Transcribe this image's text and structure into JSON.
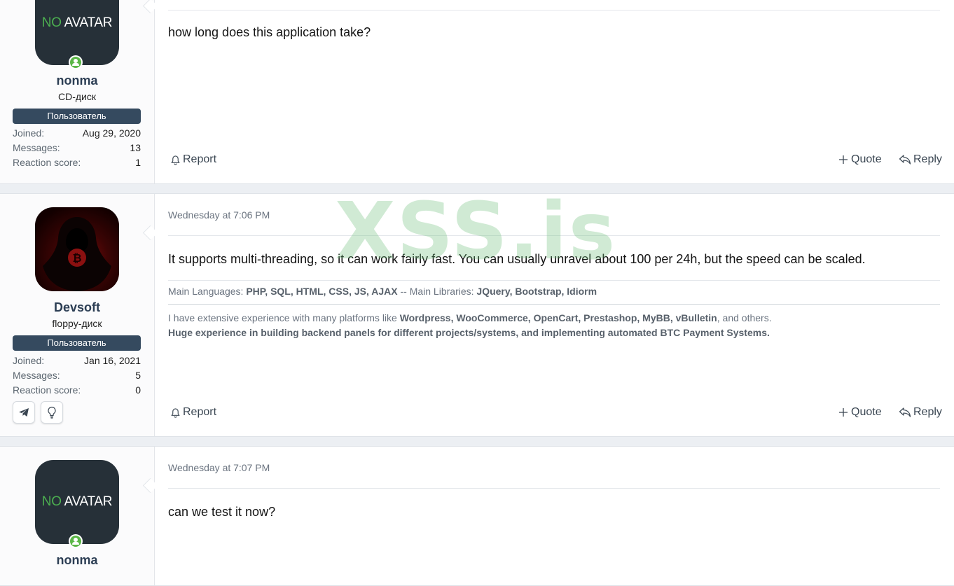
{
  "watermark": "XSS.is",
  "actions": {
    "report": "Report",
    "quote": "Quote",
    "reply": "Reply"
  },
  "stat_labels": {
    "joined": "Joined:",
    "messages": "Messages:",
    "reaction": "Reaction score:"
  },
  "posts": [
    {
      "user": {
        "avatar_no": "NO",
        "avatar_text": "AVATAR",
        "name": "nonma",
        "title": "CD-диск",
        "banner": "Пользователь",
        "joined": "Aug 29, 2020",
        "messages": "13",
        "reaction": "1"
      },
      "message": "how long does this application take?"
    },
    {
      "user": {
        "name": "Devsoft",
        "title": "floppy-диск",
        "banner": "Пользователь",
        "joined": "Jan 16, 2021",
        "messages": "5",
        "reaction": "0",
        "contacts": [
          "telegram-icon",
          "lightbulb-icon"
        ]
      },
      "date": "Wednesday at 7:06 PM",
      "message": "It supports multi-threading, so it can work fairly fast. You can usually unravel about 100 per 24h, but the speed can be scaled.",
      "signature": {
        "line1_a": "Main Languages: ",
        "line1_b": "PHP, SQL, HTML, CSS, JS, AJAX",
        "line1_c": " -- Main Libraries: ",
        "line1_d": "JQuery, Bootstrap, Idiorm",
        "line2_a": "I have extensive experience with many platforms like ",
        "line2_b": "Wordpress, WooCommerce, OpenCart, Prestashop, MyBB, vBulletin",
        "line2_c": ", and others.",
        "line3": "Huge experience in building backend panels for different projects/systems, and implementing automated BTC Payment Systems."
      }
    },
    {
      "user": {
        "avatar_no": "NO",
        "avatar_text": "AVATAR",
        "name": "nonma"
      },
      "date": "Wednesday at 7:07 PM",
      "message": "can we test it now?"
    }
  ]
}
